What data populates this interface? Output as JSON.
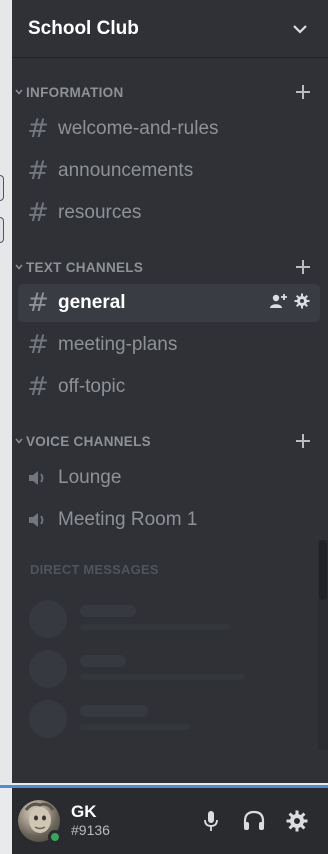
{
  "server": {
    "name": "School Club"
  },
  "categories": [
    {
      "label": "INFORMATION",
      "channels": [
        "welcome-and-rules",
        "announcements",
        "resources"
      ]
    },
    {
      "label": "TEXT CHANNELS",
      "channels": [
        "general",
        "meeting-plans",
        "off-topic"
      ],
      "active": "general"
    },
    {
      "label": "VOICE CHANNELS",
      "channels": [
        "Lounge",
        "Meeting Room 1"
      ]
    }
  ],
  "direct_messages": {
    "label": "DIRECT MESSAGES"
  },
  "user": {
    "name": "GK",
    "tag": "#9136",
    "status": "online"
  },
  "icons": {
    "hash": "#",
    "status_color": "#3ba55d",
    "accent": "#4d8ed3"
  }
}
